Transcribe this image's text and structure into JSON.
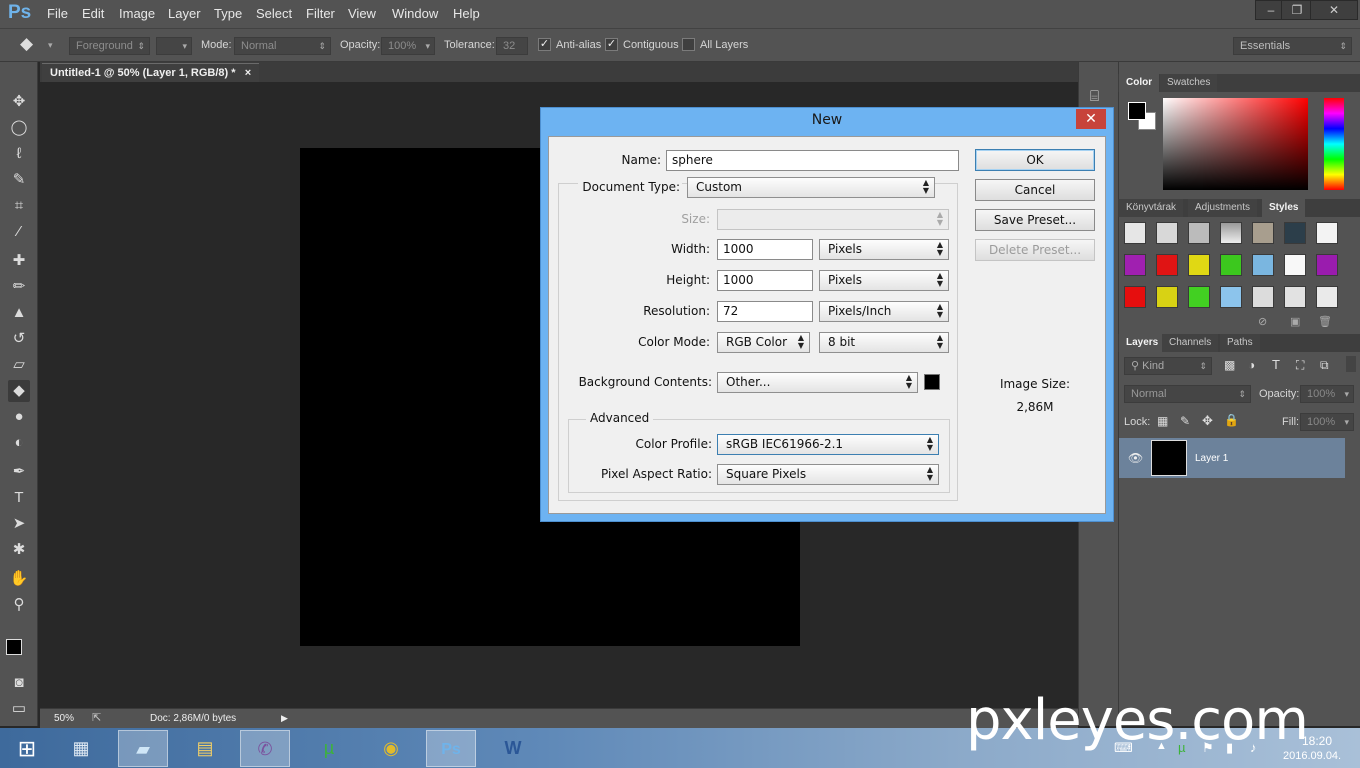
{
  "app": {
    "logo": "Ps"
  },
  "menu": [
    "File",
    "Edit",
    "Image",
    "Layer",
    "Type",
    "Select",
    "Filter",
    "View",
    "Window",
    "Help"
  ],
  "options": {
    "brush_source": "Foreground",
    "mode_label": "Mode:",
    "mode_value": "Normal",
    "opacity_label": "Opacity:",
    "opacity_value": "100%",
    "tolerance_label": "Tolerance:",
    "tolerance_value": "32",
    "anti_alias": "Anti-alias",
    "contiguous": "Contiguous",
    "all_layers": "All Layers",
    "workspace": "Essentials"
  },
  "document": {
    "tab_title": "Untitled-1 @ 50% (Layer 1, RGB/8) *",
    "tab_close": "×"
  },
  "status": {
    "zoom": "50%",
    "doc_info": "Doc: 2,86M/0 bytes"
  },
  "panels": {
    "color_tabs": [
      "Color",
      "Swatches"
    ],
    "style_tabs": [
      "Könyvtárak",
      "Adjustments",
      "Styles"
    ],
    "layer_tabs": [
      "Layers",
      "Channels",
      "Paths"
    ],
    "kind_label": "Kind",
    "blend_mode": "Normal",
    "opacity_label": "Opacity:",
    "opacity_value": "100%",
    "lock_label": "Lock:",
    "fill_label": "Fill:",
    "fill_value": "100%",
    "layer_name": "Layer 1"
  },
  "dialog": {
    "title": "New",
    "close": "✕",
    "name_label": "Name:",
    "name_value": "sphere",
    "doc_type_label": "Document Type:",
    "doc_type_value": "Custom",
    "size_label": "Size:",
    "width_label": "Width:",
    "width_value": "1000",
    "width_unit": "Pixels",
    "height_label": "Height:",
    "height_value": "1000",
    "height_unit": "Pixels",
    "resolution_label": "Resolution:",
    "resolution_value": "72",
    "resolution_unit": "Pixels/Inch",
    "color_mode_label": "Color Mode:",
    "color_mode_value": "RGB Color",
    "bit_depth": "8 bit",
    "bg_label": "Background Contents:",
    "bg_value": "Other...",
    "advanced_label": "Advanced",
    "profile_label": "Color Profile:",
    "profile_value": "sRGB IEC61966-2.1",
    "par_label": "Pixel Aspect Ratio:",
    "par_value": "Square Pixels",
    "ok": "OK",
    "cancel": "Cancel",
    "save_preset": "Save Preset...",
    "delete_preset": "Delete Preset...",
    "image_size_label": "Image Size:",
    "image_size_value": "2,86M"
  },
  "taskbar": {
    "time": "18:20",
    "date": "2016.09.04."
  },
  "watermark": "pxleyes.com",
  "colors": {
    "dialog_frame": "#6db3f2",
    "close_red": "#c7433b",
    "ps_blue": "#6fb3ea",
    "bg_color_swatch": "#000000"
  }
}
